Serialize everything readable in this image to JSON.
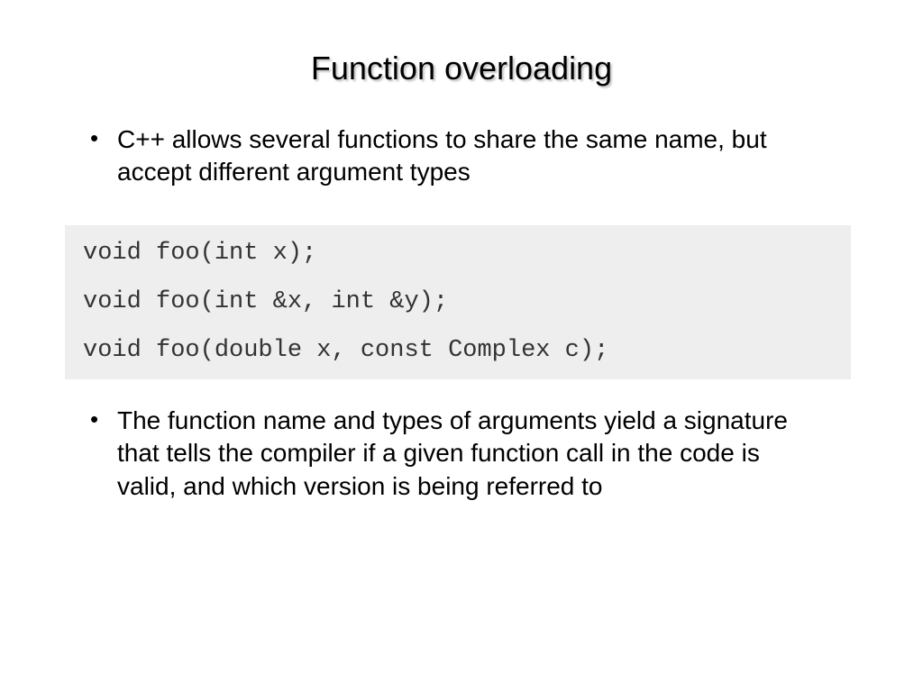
{
  "title": "Function overloading",
  "bullet1": "C++ allows several functions to share the same name, but accept different argument types",
  "code": "void foo(int x);\n\nvoid foo(int &x, int &y);\n\nvoid foo(double x, const Complex c);",
  "bullet2": "The function name and types of arguments yield a signature that tells the compiler if a given function call in the code is valid, and which version is being referred to"
}
